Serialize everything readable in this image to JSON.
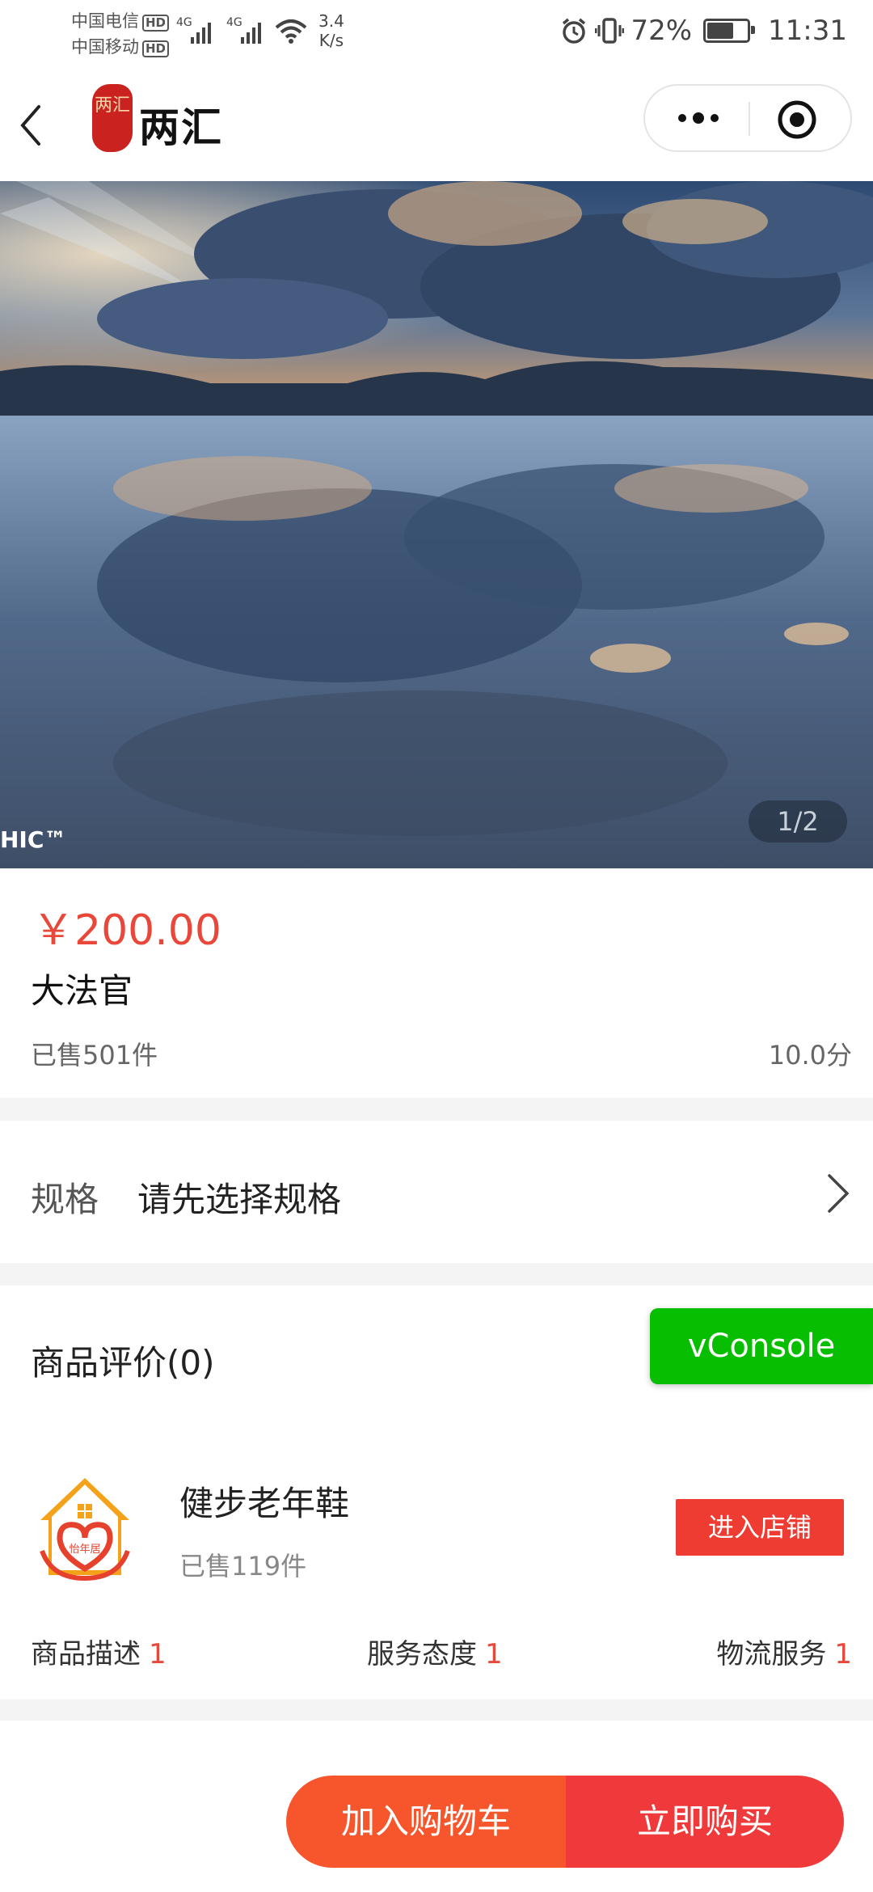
{
  "status_bar": {
    "carrier_1": "中国电信",
    "carrier_2": "中国移动",
    "hd_badge": "HD",
    "net_1": "4G",
    "net_2": "4G",
    "speed_value": "3.4",
    "speed_unit": "K/s",
    "battery_percent": "72%",
    "battery_level": 0.72,
    "time": "11:31"
  },
  "nav": {
    "logo_text": "两汇",
    "brand": "两汇"
  },
  "gallery": {
    "counter": "1/2",
    "watermark": "HIC™"
  },
  "product": {
    "price": "￥200.00",
    "title": "大法官",
    "sold": "已售501件",
    "score": "10.0分"
  },
  "spec": {
    "label": "规格",
    "value": "请先选择规格"
  },
  "reviews": {
    "title": "商品评价(0)"
  },
  "vconsole": {
    "label": "vConsole"
  },
  "shop": {
    "logo_text": "怡年居",
    "name": "健步老年鞋",
    "sold": "已售119件",
    "enter_button": "进入店铺",
    "ratings": [
      {
        "label": "商品描述",
        "value": "1"
      },
      {
        "label": "服务态度",
        "value": "1"
      },
      {
        "label": "物流服务",
        "value": "1"
      }
    ]
  },
  "actions": {
    "add_to_cart": "加入购物车",
    "buy_now": "立即购买"
  },
  "colors": {
    "accent_red": "#e8473a",
    "cart_orange": "#f7562d",
    "buy_red": "#f0393a",
    "vconsole_green": "#08be00"
  }
}
